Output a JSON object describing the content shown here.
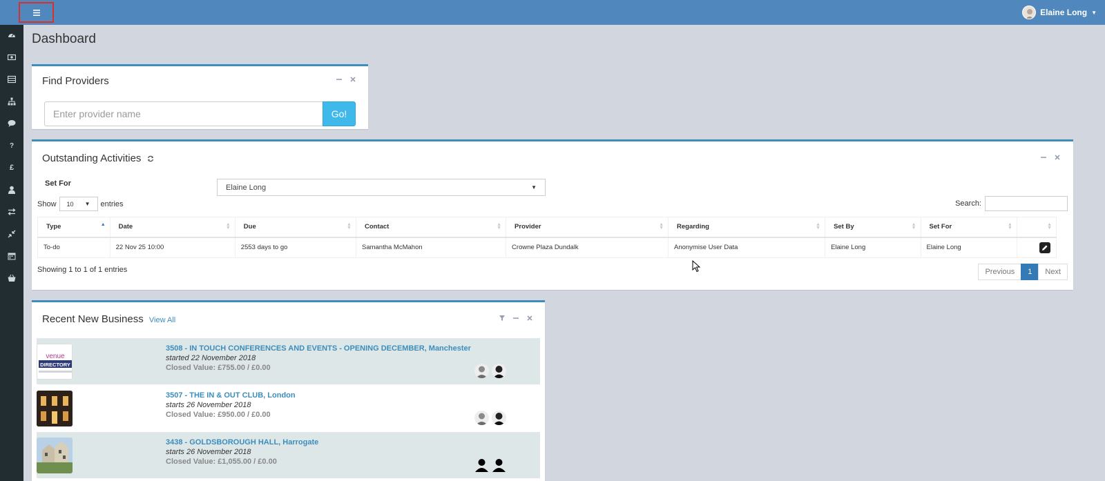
{
  "header": {
    "user_name": "Elaine Long"
  },
  "sidebar": {
    "items": [
      {
        "icon": "dashboard-icon"
      },
      {
        "icon": "money-icon"
      },
      {
        "icon": "list-icon"
      },
      {
        "icon": "sitemap-icon"
      },
      {
        "icon": "comment-icon"
      },
      {
        "icon": "question-icon"
      },
      {
        "icon": "pound-icon"
      },
      {
        "icon": "user-icon"
      },
      {
        "icon": "exchange-icon"
      },
      {
        "icon": "compress-icon"
      },
      {
        "icon": "calendar-icon"
      },
      {
        "icon": "basket-icon"
      }
    ]
  },
  "page": {
    "title": "Dashboard"
  },
  "find_providers": {
    "title": "Find Providers",
    "placeholder": "Enter provider name",
    "button_label": "Go!"
  },
  "activities": {
    "title": "Outstanding Activities",
    "set_for_label": "Set For",
    "set_for_value": "Elaine Long",
    "show_label": "Show",
    "length_value": "10",
    "entries_label": "entries",
    "search_label": "Search:",
    "columns": [
      "Type",
      "Date",
      "Due",
      "Contact",
      "Provider",
      "Regarding",
      "Set By",
      "Set For",
      ""
    ],
    "rows": [
      {
        "type": "To-do",
        "date": "22 Nov 25 10:00",
        "due": "2553 days to go",
        "contact": "Samantha McMahon",
        "provider": "Crowne Plaza Dundalk",
        "regarding": "Anonymise User Data",
        "set_by": "Elaine Long",
        "set_for": "Elaine Long"
      }
    ],
    "info": "Showing 1 to 1 of 1 entries",
    "pagination": {
      "previous": "Previous",
      "current": "1",
      "next": "Next"
    }
  },
  "recent_business": {
    "title": "Recent New Business",
    "view_all": "View All",
    "items": [
      {
        "link": "3508 - IN TOUCH CONFERENCES AND EVENTS - OPENING DECEMBER, Manchester",
        "started": "started 22 November 2018",
        "value": "Closed Value: £755.00 / £0.00",
        "thumb_text": "venue\nDIRECTORY"
      },
      {
        "link": "3507 - THE IN & OUT CLUB, London",
        "started": "starts 26 November 2018",
        "value": "Closed Value: £950.00 / £0.00"
      },
      {
        "link": "3438 - GOLDSBOROUGH HALL, Harrogate",
        "started": "starts 26 November 2018",
        "value": "Closed Value: £1,055.00 / £0.00"
      }
    ]
  },
  "colors": {
    "topbar": "#5088bd",
    "sidebar": "#222d32",
    "accent": "#3c8dbc",
    "go_button": "#3fb8ea",
    "highlight_border": "#d9302c"
  }
}
